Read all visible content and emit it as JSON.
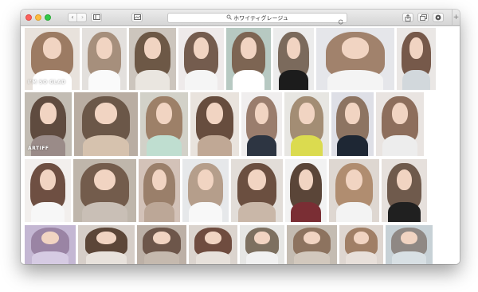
{
  "browser": {
    "address": "ホワイティグレージュ",
    "window_controls": [
      "close",
      "minimize",
      "zoom"
    ],
    "toolbar_icons": [
      "back-icon",
      "forward-icon",
      "sidebar-icon",
      "tab-overview-icon",
      "search-icon",
      "reload-icon",
      "share-icon",
      "tabs-icon",
      "extension-icon",
      "new-tab-icon"
    ]
  },
  "results": {
    "rows": [
      {
        "thumbs": [
          {
            "bg": "#e8e2dc",
            "hair": "#9c7b63",
            "top": "#ffffff",
            "caption": "I'M SO GLAD"
          },
          {
            "bg": "#e3e0dd",
            "hair": "#a68f7c",
            "top": "#fafafa"
          },
          {
            "bg": "#ccc5bd",
            "hair": "#6d5846",
            "top": "#eae6e0"
          },
          {
            "bg": "#eeeaea",
            "hair": "#745c4e",
            "top": "#f5f5f5"
          },
          {
            "bg": "#b7c9c2",
            "hair": "#7d6553",
            "top": "#ffffff"
          },
          {
            "bg": "#ececec",
            "hair": "#7b6a5c",
            "top": "#1c1c1c"
          },
          {
            "bg": "#e5e6ea",
            "hair": "#a1826c",
            "top": "#f4f4f4"
          },
          {
            "bg": "#eae7e5",
            "hair": "#76594a",
            "top": "#d2d8dc"
          }
        ]
      },
      {
        "thumbs": [
          {
            "bg": "#c2bcb3",
            "hair": "#5f4b3f",
            "top": "#9a8b88",
            "caption": "ARTIFF"
          },
          {
            "bg": "#b9ada2",
            "hair": "#6b5748",
            "top": "#d6c2ae"
          },
          {
            "bg": "#d2d1c8",
            "hair": "#9d8068",
            "top": "#bfded0"
          },
          {
            "bg": "#e9e3dd",
            "hair": "#674d3e",
            "top": "#c0a895"
          },
          {
            "bg": "#f0eeee",
            "hair": "#9a7d6d",
            "top": "#2d3542"
          },
          {
            "bg": "#e7e6e2",
            "hair": "#a38d74",
            "top": "#dbdb4f"
          },
          {
            "bg": "#dedfe6",
            "hair": "#8d7462",
            "top": "#1e2734"
          },
          {
            "bg": "#e9e4e1",
            "hair": "#8d6e5c",
            "top": "#ededed"
          }
        ]
      },
      {
        "thumbs": [
          {
            "bg": "#f2efed",
            "hair": "#6e4f42",
            "top": "#f7f7f7"
          },
          {
            "bg": "#bfb6ab",
            "hair": "#735c4c",
            "top": "#c9bfb6"
          },
          {
            "bg": "#d3c2b8",
            "hair": "#9a7f6a",
            "top": "#bca797"
          },
          {
            "bg": "#e6e8ea",
            "hair": "#b59e8b",
            "top": "#f8f8f8"
          },
          {
            "bg": "#e2ddd8",
            "hair": "#6b4f40",
            "top": "#c9b7a8"
          },
          {
            "bg": "#f2f2f2",
            "hair": "#5a4538",
            "top": "#7a2e34"
          },
          {
            "bg": "#ded7d1",
            "hair": "#b08d70",
            "top": "#f3f3f3"
          },
          {
            "bg": "#e6e0dc",
            "hair": "#6f5a4c",
            "top": "#202020"
          }
        ]
      },
      {
        "thumbs": [
          {
            "bg": "#c4b7d3",
            "hair": "#9a84a4",
            "top": "#d6cbe3"
          },
          {
            "bg": "#d6cec8",
            "hair": "#5c4638",
            "top": "#e8e2dc"
          },
          {
            "bg": "#bcb0a6",
            "hair": "#6d564a",
            "top": "#c5b9ae"
          },
          {
            "bg": "#dbd4ce",
            "hair": "#6f4c3f",
            "top": "#e7e1db"
          },
          {
            "bg": "#e6e6e4",
            "hair": "#7d7060",
            "top": "#f1f1f1"
          },
          {
            "bg": "#c4bcb2",
            "hair": "#8d735f",
            "top": "#d2c8bd"
          },
          {
            "bg": "#ded6d0",
            "hair": "#a07f66",
            "top": "#e8e0da"
          },
          {
            "bg": "#c7d1d6",
            "hair": "#8f8884",
            "top": "#d8e0e4"
          }
        ]
      }
    ]
  }
}
